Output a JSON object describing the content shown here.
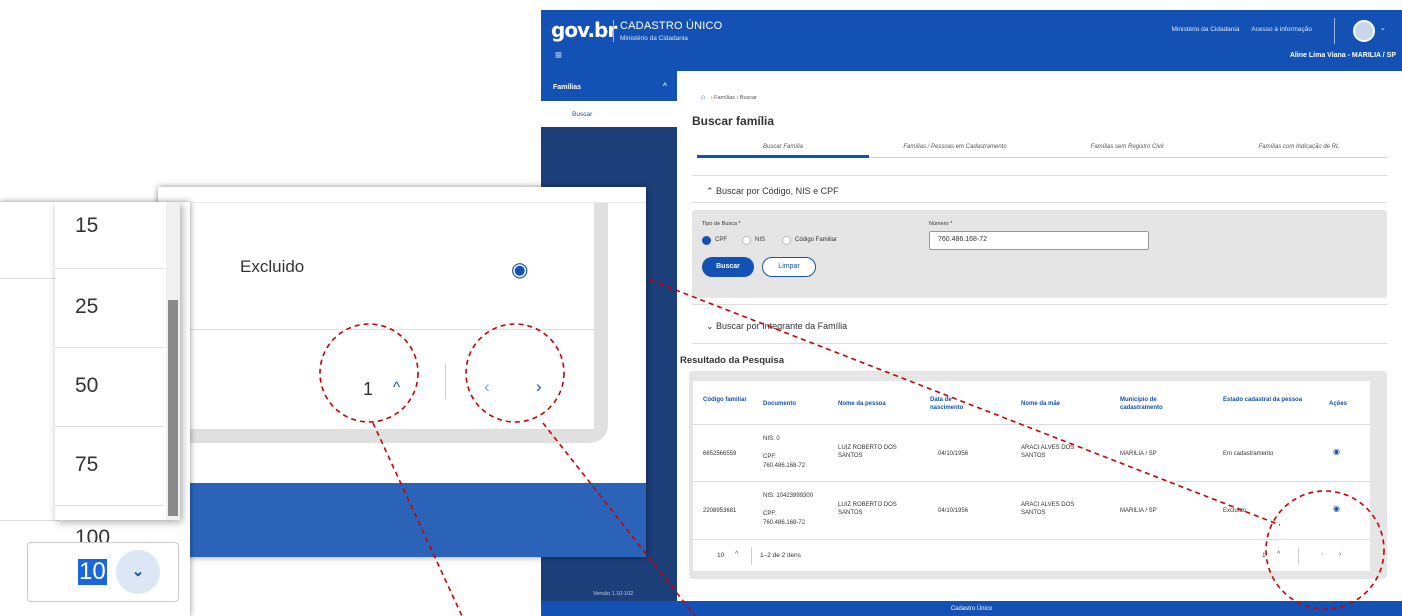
{
  "header": {
    "logo": "gov.br",
    "app_title": "CADASTRO ÚNICO",
    "app_subtitle": "Ministério da Cidadania",
    "links": [
      "Ministério da Cidadania",
      "Acesso à informação"
    ],
    "user": "Aline Lima Viana - MARILIA / SP"
  },
  "sidebar": {
    "group_label": "Famílias",
    "item_label": "Buscar",
    "version": "Versão 1.10-102"
  },
  "breadcrumb": [
    "Famílias",
    "Buscar"
  ],
  "page_title": "Buscar família",
  "tabs": [
    "Buscar Família",
    "Famílias / Pessoas em Cadastramento",
    "Famílias sem Registro Civil",
    "Famílias com Indicação de RL"
  ],
  "search_section": {
    "title": "Buscar por Código, NIS e CPF",
    "type_label": "Tipo de Busca *",
    "options": [
      "CPF",
      "NIS",
      "Código Familiar"
    ],
    "selected": "CPF",
    "number_label": "Número *",
    "number_value": "760.486.168-72",
    "btn_search": "Buscar",
    "btn_clear": "Limpar"
  },
  "member_section": {
    "title": "Buscar por Integrante da Família"
  },
  "results": {
    "title": "Resultado da Pesquisa",
    "headers": [
      "Código familiar",
      "Documento",
      "Nome da pessoa",
      "Data de nascimento",
      "Nome da mãe",
      "Município de cadastramento",
      "Estado cadastral da pessoa",
      "Ações"
    ],
    "rows": [
      {
        "codigo": "6652566559",
        "nis": "NIS: 0",
        "cpf_label": "CPF:",
        "cpf": "760.486.168-72",
        "nome": "LUIZ ROBERTO DOS SANTOS",
        "nascimento": "04/10/1956",
        "mae": "ARACI ALVES DOS SANTOS",
        "municipio": "MARILIA / SP",
        "estado": "Em cadastramento"
      },
      {
        "codigo": "2208953681",
        "nis": "NIS: 10423999300",
        "cpf_label": "CPF:",
        "cpf": "760.486.168-72",
        "nome": "LUIZ ROBERTO DOS SANTOS",
        "nascimento": "04/10/1956",
        "mae": "ARACI ALVES DOS SANTOS",
        "municipio": "MARILIA / SP",
        "estado": "Excluído"
      }
    ],
    "per_page": "10",
    "range_text": "1–2 de 2 itens",
    "page": "1"
  },
  "footer": "Cadastro Único",
  "zoom": {
    "status_text": "Excluido",
    "page": "1",
    "page_size_options": [
      "15",
      "25",
      "50",
      "75",
      "100"
    ],
    "selected_page_size": "10"
  },
  "colors": {
    "brand_blue": "#1351b4",
    "sidebar_dark": "#1c3f7a",
    "annotation_red": "#cc0000"
  }
}
